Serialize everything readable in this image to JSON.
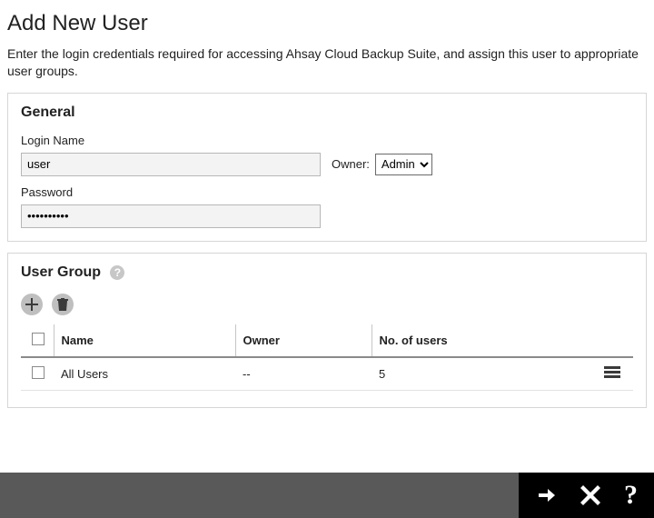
{
  "page": {
    "title": "Add New User",
    "description": "Enter the login credentials required for accessing Ahsay Cloud Backup Suite, and assign this user to appropriate user groups."
  },
  "general": {
    "heading": "General",
    "login_name_label": "Login Name",
    "login_name_value": "user",
    "owner_label": "Owner:",
    "owner_selected": "Admin",
    "password_label": "Password",
    "password_value": "••••••••••"
  },
  "user_group": {
    "heading": "User Group",
    "columns": {
      "name": "Name",
      "owner": "Owner",
      "num_users": "No. of users"
    },
    "rows": [
      {
        "name": "All Users",
        "owner": "--",
        "num_users": "5"
      }
    ]
  },
  "footer": {
    "help_glyph": "?"
  }
}
